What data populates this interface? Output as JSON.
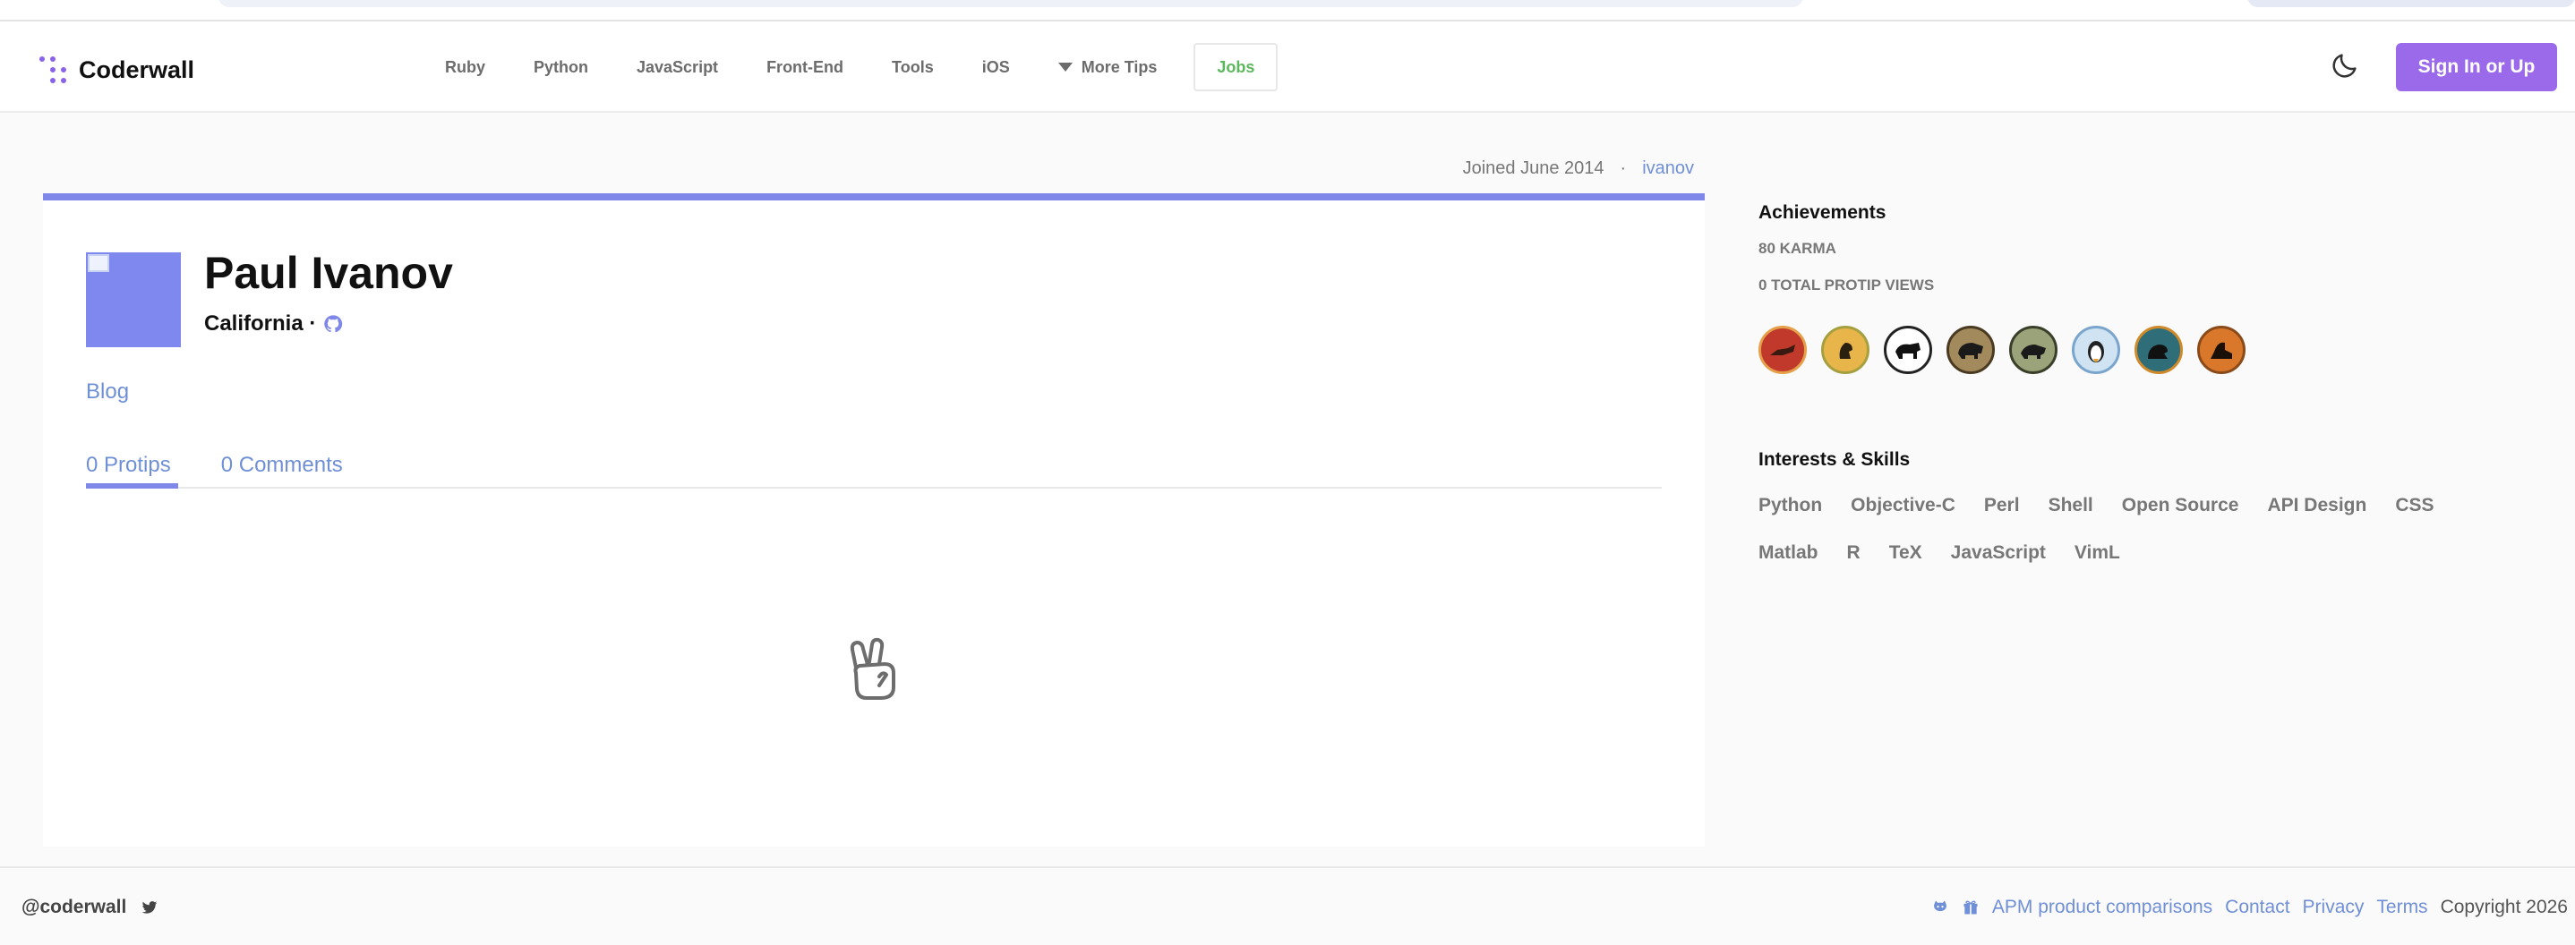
{
  "brand": {
    "name": "Coderwall",
    "accent": "#8a63e8"
  },
  "nav": {
    "items": [
      "Ruby",
      "Python",
      "JavaScript",
      "Front-End",
      "Tools",
      "iOS"
    ],
    "more_label": "More Tips",
    "jobs_label": "Jobs"
  },
  "header": {
    "signin_label": "Sign In or Up",
    "theme_icon": "moon-icon"
  },
  "profile": {
    "joined": "Joined June 2014",
    "separator": "·",
    "username": "ivanov",
    "name": "Paul Ivanov",
    "location": "California ·",
    "blog_label": "Blog",
    "tabs": [
      "0 Protips",
      "0 Comments"
    ],
    "accent": "#7f88e8"
  },
  "achievements": {
    "title": "Achievements",
    "karma": "80 KARMA",
    "views": "0 TOTAL PROTIP VIEWS",
    "badges": [
      {
        "name": "badge-1",
        "bg": "#c0392b",
        "ring": "#e5a04a"
      },
      {
        "name": "badge-2",
        "bg": "#e8b54a",
        "ring": "#a4a040"
      },
      {
        "name": "badge-3",
        "bg": "#ffffff",
        "ring": "#222222"
      },
      {
        "name": "badge-4",
        "bg": "#a38a5c",
        "ring": "#4a3a22"
      },
      {
        "name": "badge-5",
        "bg": "#9aa37a",
        "ring": "#3a3f2a"
      },
      {
        "name": "badge-6",
        "bg": "#cfe3f3",
        "ring": "#7aa5cc"
      },
      {
        "name": "badge-7",
        "bg": "#2f6e78",
        "ring": "#d08a2a"
      },
      {
        "name": "badge-8",
        "bg": "#d9782a",
        "ring": "#8a4a1a"
      }
    ]
  },
  "skills": {
    "title": "Interests & Skills",
    "items": [
      "Python",
      "Objective-C",
      "Perl",
      "Shell",
      "Open Source",
      "API Design",
      "CSS",
      "Matlab",
      "R",
      "TeX",
      "JavaScript",
      "VimL"
    ]
  },
  "footer": {
    "handle": "@coderwall",
    "links": [
      "APM product comparisons",
      "Contact",
      "Privacy",
      "Terms"
    ],
    "copyright": "Copyright 2026"
  }
}
